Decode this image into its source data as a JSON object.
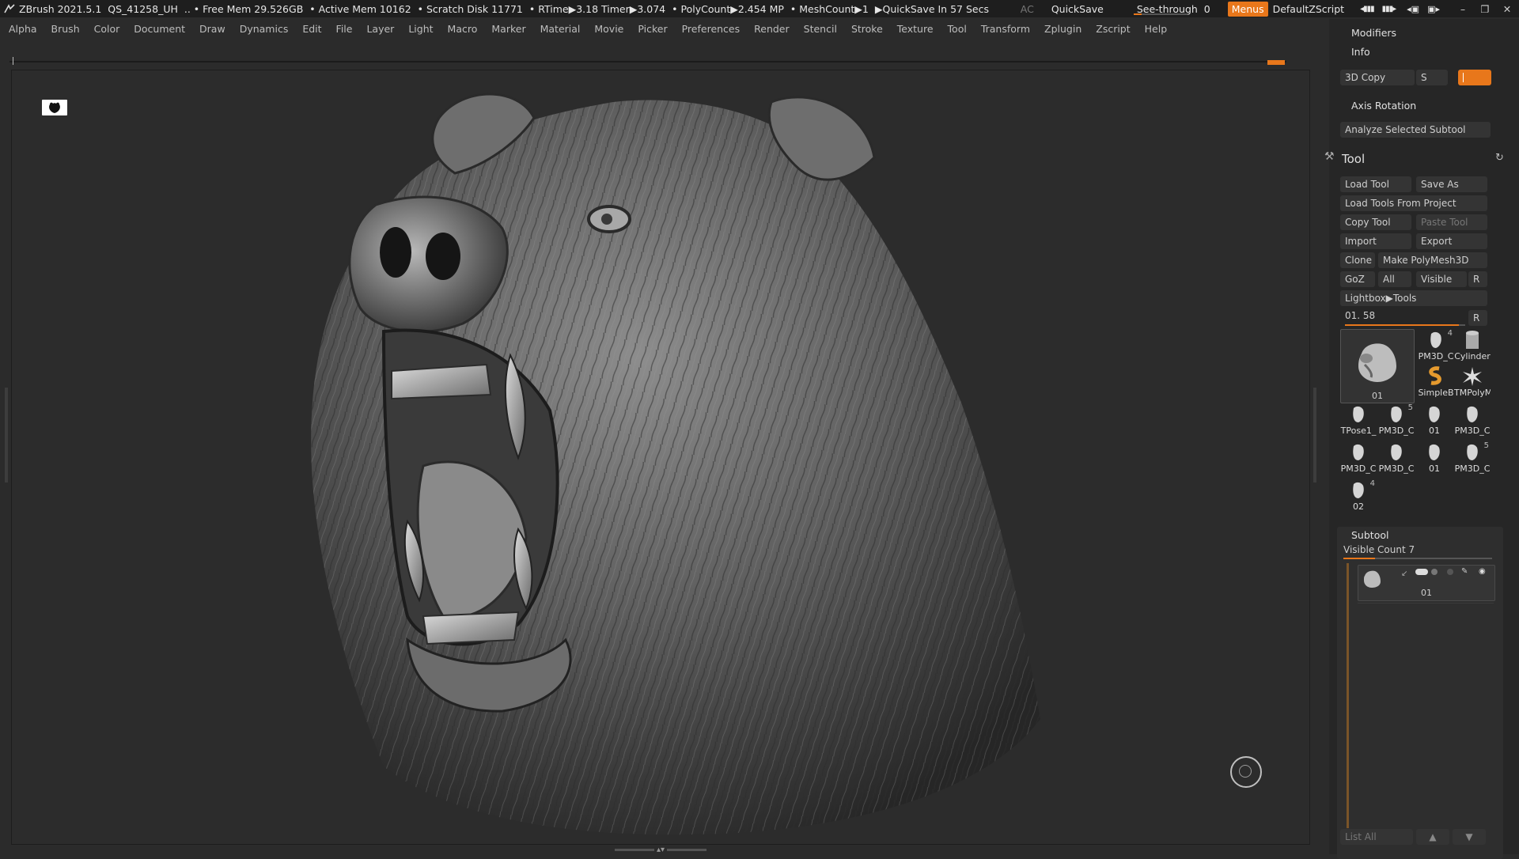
{
  "titlebar": {
    "app": "ZBrush 2021.5.1",
    "doc": "QS_41258_UH",
    "free_mem": ".. • Free Mem 29.526GB",
    "active_mem": "• Active Mem 10162",
    "scratch": "• Scratch Disk 11771",
    "rtime": "• RTime▶3.18 Timer▶3.074",
    "polycount": "• PolyCount▶2.454 MP",
    "meshcount": "• MeshCount▶1",
    "quicksave_timer": "▶QuickSave In 57 Secs",
    "ac": "AC",
    "quicksave": "QuickSave",
    "see_through_label": "See-through",
    "see_through_value": "0",
    "see_through_level": 0,
    "menus": "Menus",
    "default_zscript": "DefaultZScript"
  },
  "menubar": [
    "Alpha",
    "Brush",
    "Color",
    "Document",
    "Draw",
    "Dynamics",
    "Edit",
    "File",
    "Layer",
    "Light",
    "Macro",
    "Marker",
    "Material",
    "Movie",
    "Picker",
    "Preferences",
    "Render",
    "Stencil",
    "Stroke",
    "Texture",
    "Tool",
    "Transform",
    "Zplugin",
    "Zscript",
    "Help"
  ],
  "panel": {
    "modifiers": "Modifiers",
    "info": "Info",
    "copy3d": "3D Copy",
    "s": "S",
    "axis_rotation": "Axis Rotation",
    "analyze": "Analyze Selected Subtool",
    "tool_title": "Tool",
    "load_tool": "Load Tool",
    "save_as": "Save As",
    "load_from_project": "Load Tools From Project",
    "copy_tool": "Copy Tool",
    "paste_tool": "Paste Tool",
    "import": "Import",
    "export": "Export",
    "clone": "Clone",
    "make_polymesh": "Make PolyMesh3D",
    "goz": "GoZ",
    "all": "All",
    "visible": "Visible",
    "r": "R",
    "lightbox": "Lightbox▶Tools",
    "tool_slider": "01. 58",
    "tool_slider_r": "R",
    "tool_slider_level": 0.95,
    "main_thumb": "01",
    "thumbs_row1": [
      {
        "label": "PM3D_C",
        "num": "4"
      },
      {
        "label": "Cylinder",
        "num": ""
      }
    ],
    "thumbs_row2": [
      {
        "label": "SimpleB",
        "num": ""
      },
      {
        "label": "TMPolyM",
        "num": ""
      }
    ],
    "thumbs_row3": [
      {
        "label": "TPose1_",
        "num": ""
      },
      {
        "label": "PM3D_C",
        "num": "5"
      },
      {
        "label": "01",
        "num": ""
      },
      {
        "label": "PM3D_C",
        "num": ""
      }
    ],
    "thumbs_row4": [
      {
        "label": "PM3D_C",
        "num": ""
      },
      {
        "label": "PM3D_C",
        "num": ""
      },
      {
        "label": "01",
        "num": ""
      },
      {
        "label": "PM3D_C",
        "num": "5"
      }
    ],
    "thumbs_row5": [
      {
        "label": "02",
        "num": "4"
      }
    ],
    "subtool": "Subtool",
    "visible_count": "Visible Count 7",
    "subtool_item": "01",
    "list_all": "List All"
  },
  "colors": {
    "accent": "#e8771b",
    "panel": "#262626",
    "viewport": "#2c2c2c"
  }
}
